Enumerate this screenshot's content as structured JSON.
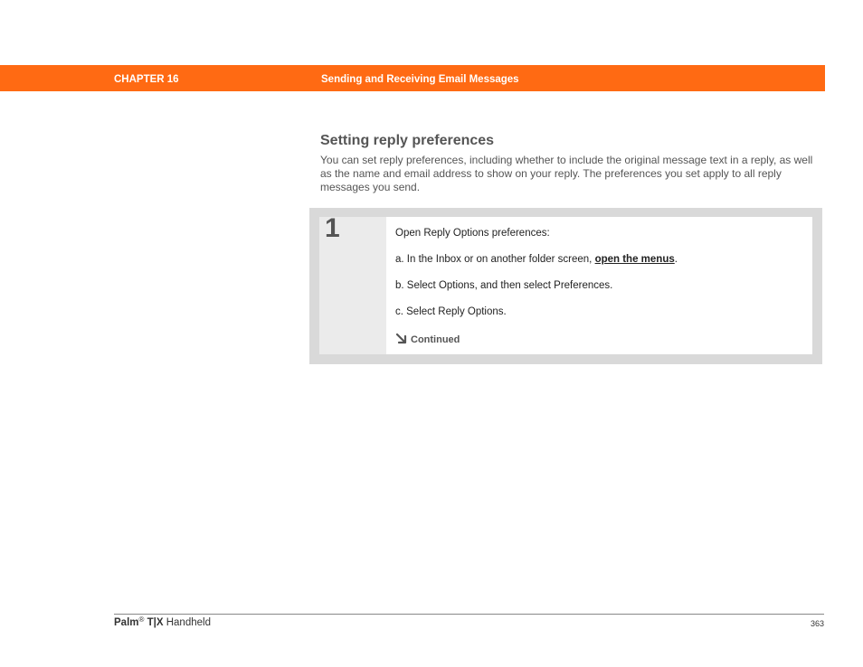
{
  "header": {
    "chapter": "CHAPTER 16",
    "title": "Sending and Receiving Email Messages",
    "bar_color": "#ff6a13"
  },
  "section": {
    "title": "Setting reply preferences",
    "intro": "You can set reply preferences, including whether to include the original message text in a reply, as well as the name and email address to show on your reply. The preferences you set apply to all reply messages you send."
  },
  "step": {
    "number": "1",
    "intro": "Open Reply Options preferences:",
    "item_a_prefix": "a.  In the Inbox or on another folder screen, ",
    "item_a_link": "open the menus",
    "item_a_suffix": ".",
    "item_b": "b.  Select Options, and then select Preferences.",
    "item_c": "c.  Select Reply Options.",
    "continued": "Continued",
    "continued_icon": "arrow-down-right-icon"
  },
  "footer": {
    "brand": "Palm",
    "registered": "®",
    "model": "T|X",
    "product": "Handheld",
    "page": "363"
  }
}
